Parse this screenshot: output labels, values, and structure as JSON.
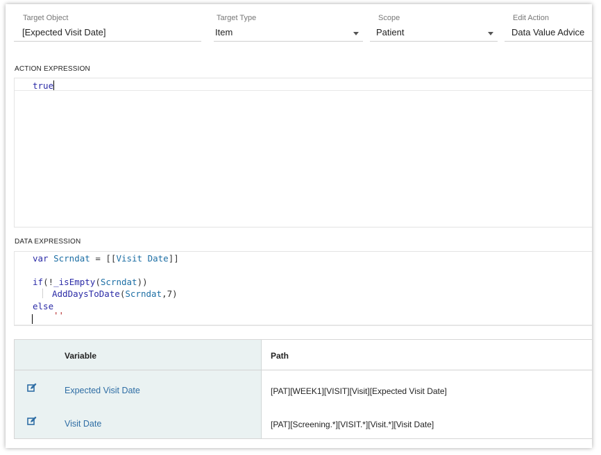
{
  "fields": {
    "target_object": {
      "label": "Target Object",
      "value": "[Expected Visit Date]"
    },
    "target_type": {
      "label": "Target Type",
      "value": "Item"
    },
    "scope": {
      "label": "Scope",
      "value": "Patient"
    },
    "edit_action": {
      "label": "Edit Action",
      "value": "Data Value Advice"
    }
  },
  "action_expression": {
    "label": "ACTION EXPRESSION",
    "code": "true"
  },
  "data_expression": {
    "label": "DATA EXPRESSION",
    "line1_kw": "var",
    "line1_var": "Scrndat",
    "line1_op": " = [[",
    "line1_ref": "Visit Date",
    "line1_end": "]]",
    "line3_kw": "if",
    "line3_op1": "(!",
    "line3_fn": "_isEmpty",
    "line3_op2": "(",
    "line3_var": "Scrndat",
    "line3_op3": "))",
    "line4_fn": "AddDaysToDate",
    "line4_op1": "(",
    "line4_var": "Scrndat",
    "line4_op2": ",7)",
    "line5_kw": "else",
    "line6": "''"
  },
  "table": {
    "headers": {
      "variable": "Variable",
      "path": "Path"
    },
    "rows": [
      {
        "variable": "Expected Visit Date",
        "path": "[PAT][WEEK1][VISIT][Visit][Expected Visit Date]"
      },
      {
        "variable": "Visit Date",
        "path": "[PAT][Screening.*][VISIT.*][Visit.*][Visit Date]"
      }
    ]
  },
  "colors": {
    "link": "#2e6da4",
    "keyword": "#2a2aa6",
    "left_col_bg": "#eaf2f2"
  }
}
